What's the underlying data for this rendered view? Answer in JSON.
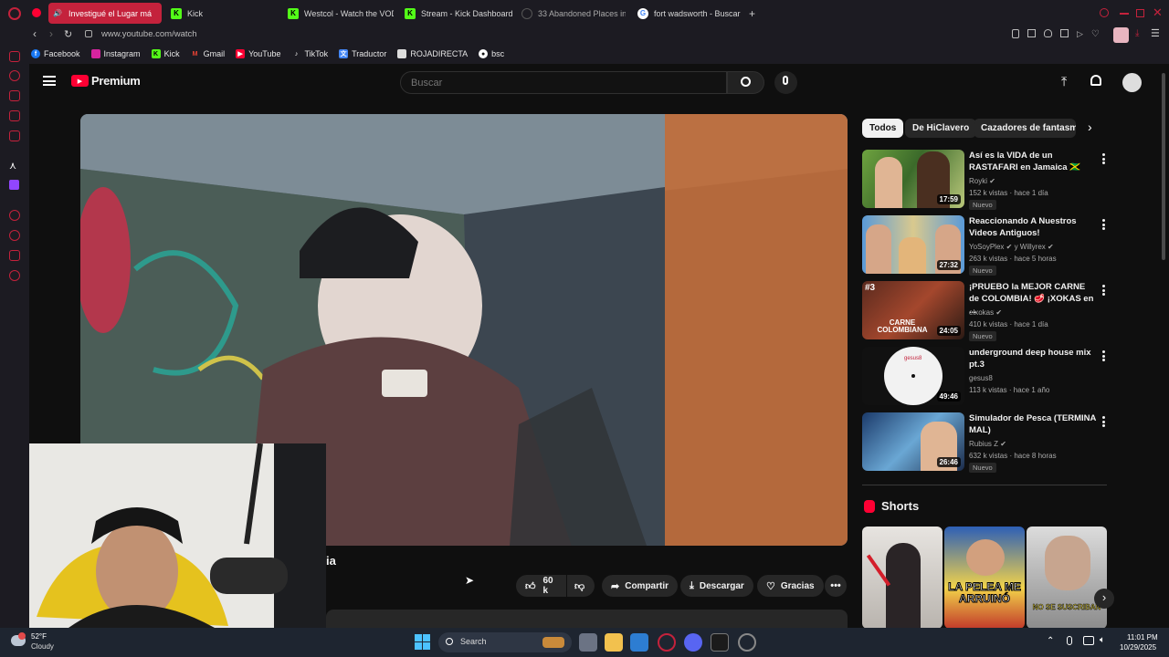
{
  "browser": {
    "tabs": [
      {
        "label": "Investigué el Lugar má",
        "active": true
      },
      {
        "label": "Kick"
      },
      {
        "label": "Westcol - Watch the VOD"
      },
      {
        "label": "Stream - Kick Dashboard"
      },
      {
        "label": "33 Abandoned Places in"
      },
      {
        "label": "fort wadsworth - Buscar c"
      }
    ],
    "url": "www.youtube.com/watch",
    "bookmarks": [
      "Facebook",
      "Instagram",
      "Kick",
      "Gmail",
      "YouTube",
      "TikTok",
      "Traductor",
      "ROJADIRECTA",
      "bsc"
    ]
  },
  "youtube": {
    "logo_text": "Premium",
    "search_placeholder": "Buscar",
    "video": {
      "title_fragment": "ia",
      "likes": "60 k",
      "share_label": "Compartir",
      "download_label": "Descargar",
      "thanks_label": "Gracias"
    },
    "chips": [
      "Todos",
      "De HiClavero",
      "Cazadores de fantasmas"
    ],
    "recommendations": [
      {
        "title": "Así es la VIDA de un RASTAFARI en Jamaica 🇯🇲",
        "channel": "Royki",
        "meta": "152 k vistas · hace 1 día",
        "badge": "Nuevo",
        "duration": "17:59"
      },
      {
        "title": "Reaccionando A Nuestros Videos Antiguos!",
        "channel": "YoSoyPlex",
        "channel_extra": "y Willyrex",
        "meta": "263 k vistas · hace 5 horas",
        "badge": "Nuevo",
        "duration": "27:32"
      },
      {
        "title": "¡PRUEBO la MEJOR CARNE de COLOMBIA! 🥩 ¡XOKAS en ...",
        "channel": "elxokas",
        "meta": "410 k vistas · hace 1 día",
        "badge": "Nuevo",
        "duration": "24:05",
        "thumb_text": "CARNE COLOMBIANA",
        "thumb_rank": "#3"
      },
      {
        "title": "underground deep house mix pt.3",
        "channel": "gesus8",
        "meta": "113 k vistas · hace 1 año",
        "duration": "49:46",
        "thumb_text": "gesus8"
      },
      {
        "title": "Simulador de Pesca (TERMINA MAL)",
        "channel": "Rubius Z",
        "meta": "632 k vistas · hace 8 horas",
        "badge": "Nuevo",
        "duration": "26:46"
      }
    ],
    "shorts_heading": "Shorts",
    "shorts": [
      {
        "overlay": ""
      },
      {
        "overlay": "LA PELEA ME ARRUINÓ"
      },
      {
        "overlay": "NO SE SUSCRIBAN"
      }
    ]
  },
  "taskbar": {
    "weather_temp": "52°F",
    "weather_desc": "Cloudy",
    "search_label": "Search",
    "time": "11:01 PM",
    "date": "10/29/2025"
  },
  "colors": {
    "opera_red": "#c4223c",
    "yt_red": "#ff0033",
    "kick_green": "#53fc18"
  }
}
